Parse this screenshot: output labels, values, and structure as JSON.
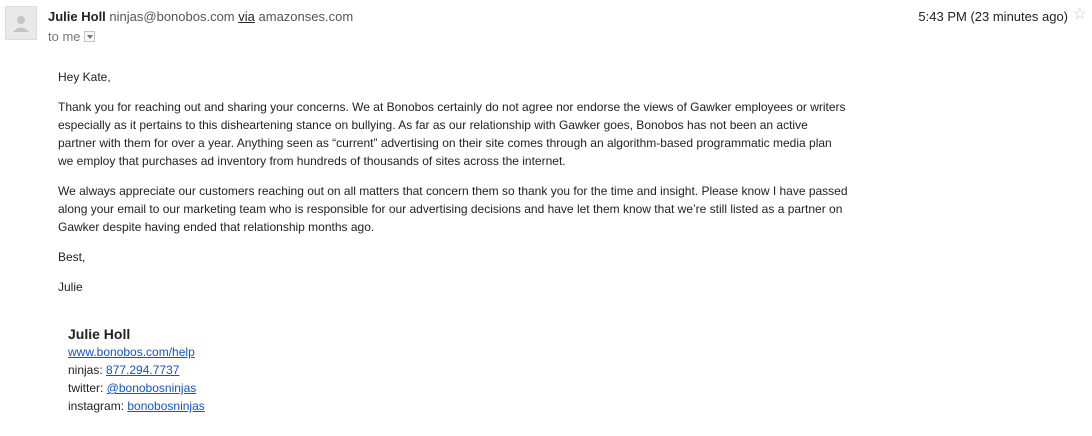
{
  "header": {
    "avatar_icon": "default-avatar-icon",
    "sender_name": "Julie Holl",
    "sender_email": "ninjas@bonobos.com",
    "via_label": "via",
    "via_domain": "amazonses.com",
    "to_label": "to me",
    "timestamp": "5:43 PM (23 minutes ago)",
    "star_icon": "star-icon"
  },
  "message": {
    "greeting": "Hey Kate,",
    "paragraph1": "Thank you for reaching out and sharing your concerns. We at Bonobos certainly do not agree nor endorse the views of Gawker employees or writers especially as it pertains to this disheartening stance on bullying. As far as our relationship with Gawker goes, Bonobos has not been an active partner with them for over a year. Anything seen as “current” advertising on their site comes through an algorithm-based programmatic media plan we employ that purchases ad inventory from hundreds of thousands of sites across the internet.",
    "paragraph2": "We always appreciate our customers reaching out on all matters that concern them so thank you for the time and insight. Please know I have passed along your email to our marketing team who is responsible for our advertising decisions and have let them know that we’re still listed as a partner on Gawker despite having ended that relationship months ago.",
    "closing": "Best,",
    "sign_off": "Julie"
  },
  "signature": {
    "name": "Julie Holl",
    "website": "www.bonobos.com/help",
    "ninjas_label": "ninjas: ",
    "ninjas_phone": "877.294.7737",
    "twitter_label": "twitter: ",
    "twitter_handle": "@bonobosninjas",
    "instagram_label": "instagram: ",
    "instagram_handle": "bonobosninjas"
  },
  "colors": {
    "link": "#1155cc",
    "muted_text": "#555555",
    "star": "#c8c8c8"
  }
}
